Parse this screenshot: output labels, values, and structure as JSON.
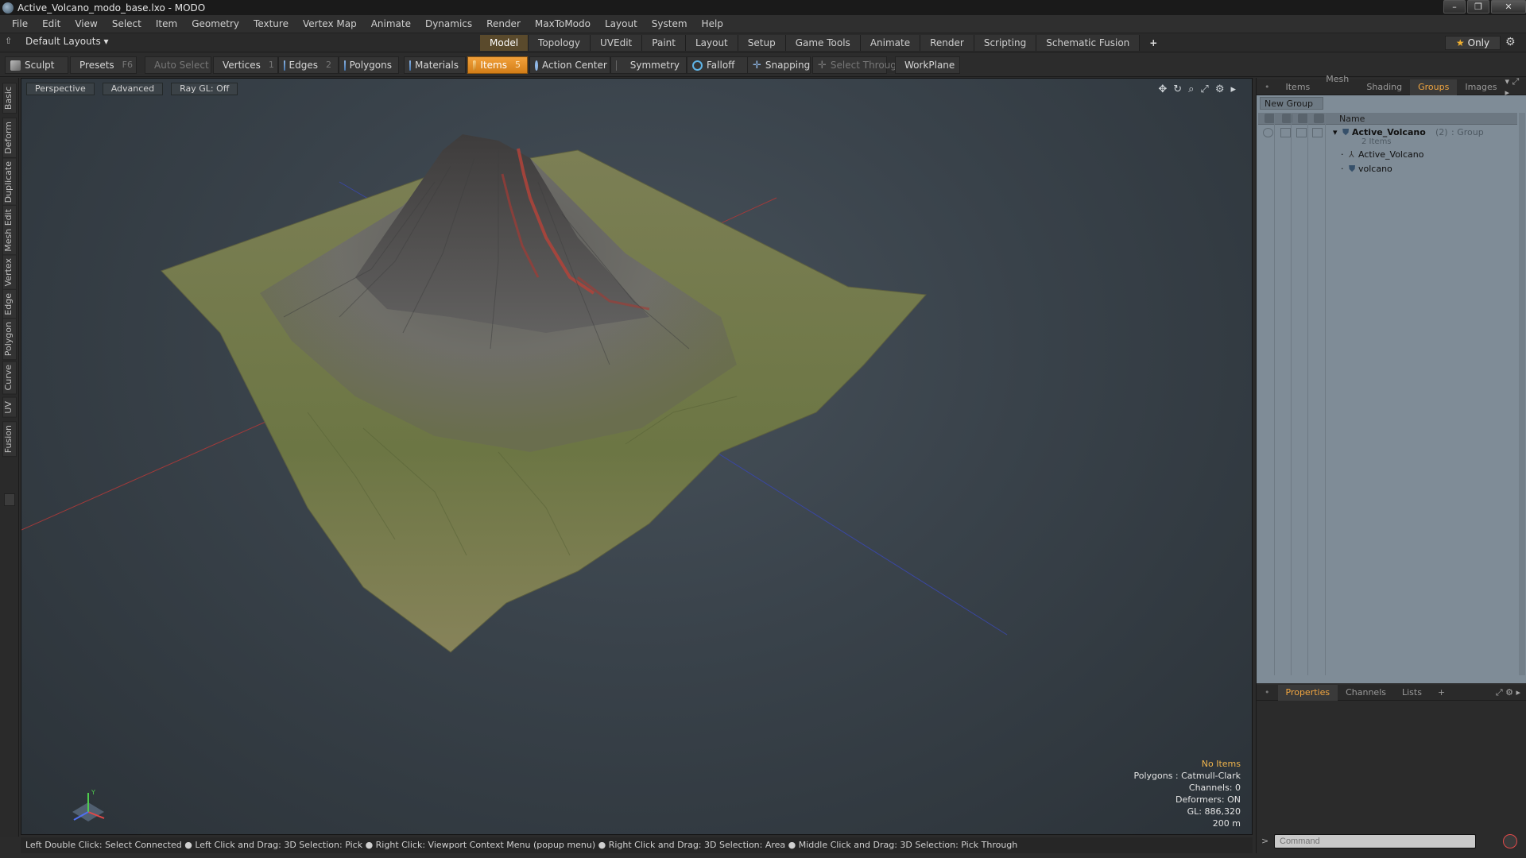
{
  "window": {
    "title": "Active_Volcano_modo_base.lxo - MODO"
  },
  "menubar": [
    "File",
    "Edit",
    "View",
    "Select",
    "Item",
    "Geometry",
    "Texture",
    "Vertex Map",
    "Animate",
    "Dynamics",
    "Render",
    "MaxToModo",
    "Layout",
    "System",
    "Help"
  ],
  "layout_bar": {
    "layouts_label": "Default Layouts ▾",
    "tabs": [
      "Model",
      "Topology",
      "UVEdit",
      "Paint",
      "Layout",
      "Setup",
      "Game Tools",
      "Animate",
      "Render",
      "Scripting",
      "Schematic Fusion"
    ],
    "active_tab": "Model",
    "add_tab": "+",
    "only_label": "Only"
  },
  "toolbar": {
    "sculpt": "Sculpt",
    "presets": "Presets",
    "presets_key": "F6",
    "auto_select": "Auto Select",
    "vertices": "Vertices",
    "vertices_key": "1",
    "edges": "Edges",
    "edges_key": "2",
    "polygons": "Polygons",
    "materials": "Materials",
    "items": "Items",
    "items_key": "5",
    "action_center": "Action Center",
    "symmetry": "Symmetry",
    "falloff": "Falloff",
    "snapping": "Snapping",
    "select_through": "Select Through",
    "workplane": "WorkPlane"
  },
  "left_tabs": [
    "Basic",
    "Deform",
    "Duplicate",
    "Mesh Edit",
    "Vertex",
    "Edge",
    "Polygon",
    "Curve",
    "UV",
    "Fusion"
  ],
  "viewport": {
    "view": "Perspective",
    "mode": "Advanced",
    "raygl": "Ray GL: Off",
    "info": {
      "no_items": "No Items",
      "polygons": "Polygons : Catmull-Clark",
      "channels": "Channels: 0",
      "deformers": "Deformers: ON",
      "gl": "GL: 886,320",
      "scale": "200 m"
    }
  },
  "statusbar": "Left Double Click: Select Connected ● Left Click and Drag: 3D Selection: Pick ● Right Click: Viewport Context Menu (popup menu) ● Right Click and Drag: 3D Selection: Area ● Middle Click and Drag: 3D Selection: Pick Through",
  "right_panel": {
    "tabs": [
      "Items",
      "Mesh ...",
      "Shading",
      "Groups",
      "Images"
    ],
    "active_tab": "Groups",
    "new_group": "New Group",
    "name_column": "Name",
    "group": {
      "name": "Active_Volcano",
      "count": "(2)",
      "type": ": Group",
      "items_label": "2 Items"
    },
    "children": [
      "Active_Volcano",
      "volcano"
    ],
    "bottom_tabs": [
      "Properties",
      "Channels",
      "Lists",
      "+"
    ],
    "bottom_active": "Properties",
    "command_placeholder": "Command"
  },
  "colors": {
    "accent": "#F2A640",
    "active_tool": "#E8901F",
    "lava": "#C0392B"
  }
}
